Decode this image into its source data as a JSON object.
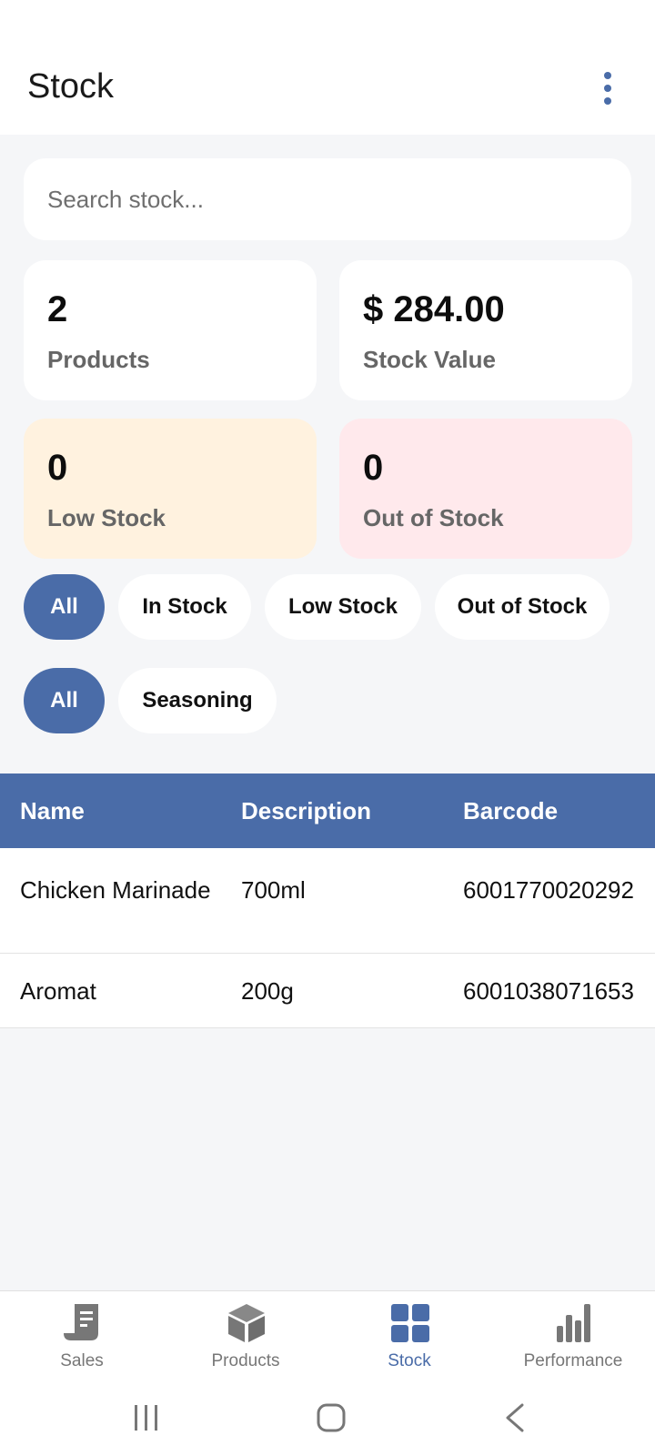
{
  "header": {
    "title": "Stock"
  },
  "search": {
    "placeholder": "Search stock..."
  },
  "stats": {
    "products": {
      "value": "2",
      "label": "Products"
    },
    "stock_value": {
      "value": "$ 284.00",
      "label": "Stock Value"
    },
    "low_stock": {
      "value": "0",
      "label": "Low Stock"
    },
    "out_of_stock": {
      "value": "0",
      "label": "Out of Stock"
    }
  },
  "status_filters": [
    "All",
    "In Stock",
    "Low Stock",
    "Out of Stock"
  ],
  "category_filters": [
    "All",
    "Seasoning"
  ],
  "table": {
    "headers": [
      "Name",
      "Description",
      "Barcode"
    ],
    "rows": [
      {
        "name": "Chicken Marinade",
        "description": "700ml",
        "barcode": "6001770020292"
      },
      {
        "name": "Aromat",
        "description": "200g",
        "barcode": "6001038071653"
      }
    ]
  },
  "bottom_nav": [
    {
      "label": "Sales",
      "icon": "receipt-icon"
    },
    {
      "label": "Products",
      "icon": "box-icon"
    },
    {
      "label": "Stock",
      "icon": "grid-icon"
    },
    {
      "label": "Performance",
      "icon": "bar-chart-icon"
    }
  ],
  "colors": {
    "accent": "#4a6ca8",
    "low_stock_bg": "#fff2df",
    "out_stock_bg": "#ffe9ec"
  }
}
